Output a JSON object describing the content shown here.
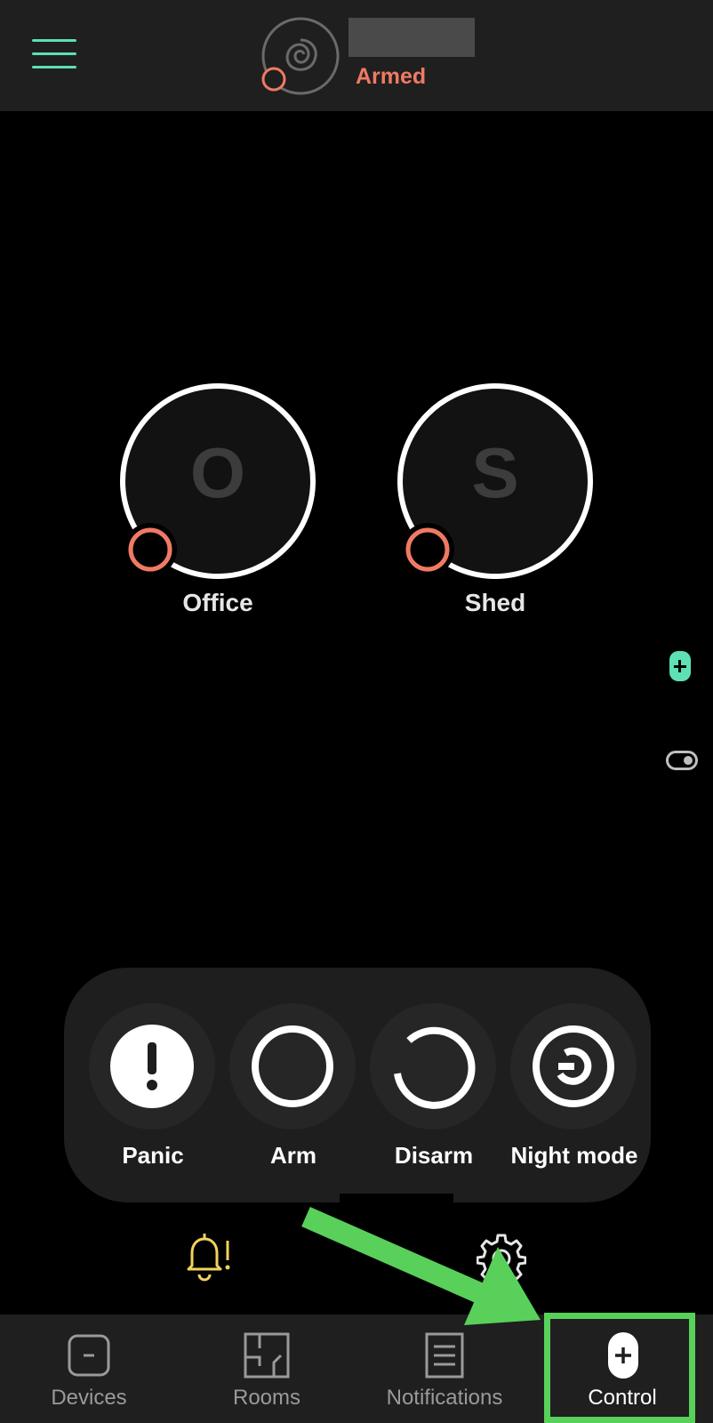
{
  "header": {
    "menu_icon": "hamburger-menu-icon",
    "hub_status": "Armed",
    "status_color": "#f07a64"
  },
  "rooms": [
    {
      "initial": "O",
      "name": "Office"
    },
    {
      "initial": "S",
      "name": "Shed"
    }
  ],
  "side_actions": {
    "add_icon": "plus-icon",
    "toggle_icon": "toggle-icon",
    "accent": "#5ee0b4"
  },
  "controls": [
    {
      "label": "Panic",
      "icon": "exclamation-icon"
    },
    {
      "label": "Arm",
      "icon": "ring-icon"
    },
    {
      "label": "Disarm",
      "icon": "open-ring-icon"
    },
    {
      "label": "Night mode",
      "icon": "night-mode-icon"
    }
  ],
  "quick_icons": {
    "notifications": "bell-alert-icon",
    "settings": "gear-icon"
  },
  "bottom_nav": [
    {
      "label": "Devices",
      "icon": "devices-icon"
    },
    {
      "label": "Rooms",
      "icon": "rooms-icon"
    },
    {
      "label": "Notifications",
      "icon": "notifications-icon"
    },
    {
      "label": "Control",
      "icon": "control-icon",
      "active": true
    }
  ],
  "annotation": {
    "color": "#58d05a"
  }
}
